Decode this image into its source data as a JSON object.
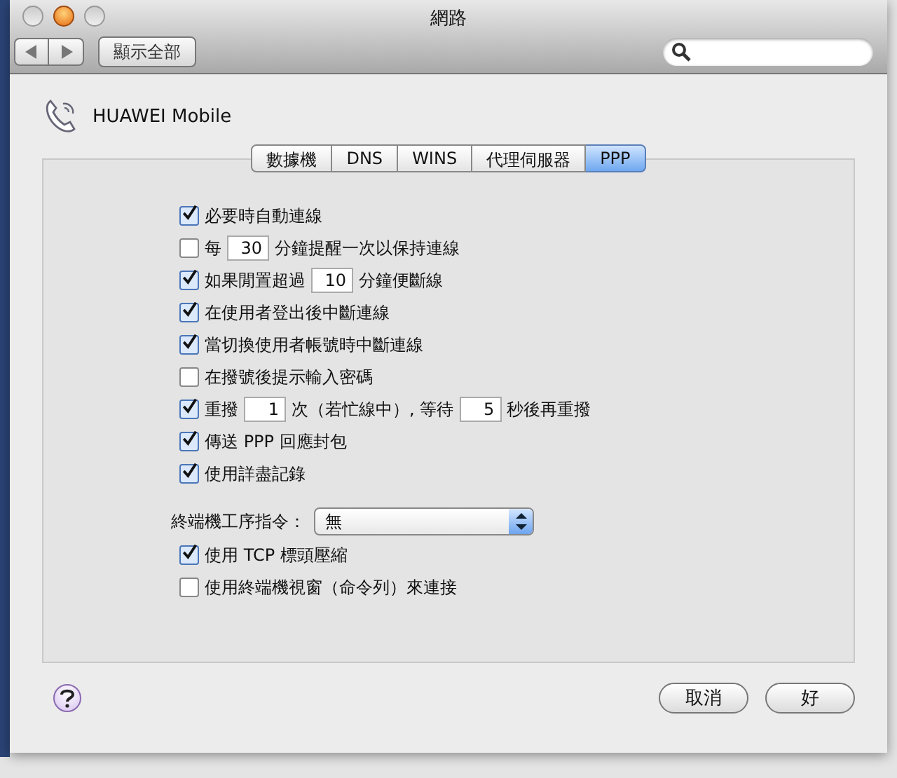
{
  "window": {
    "title": "網路",
    "show_all_button": "顯示全部"
  },
  "device": {
    "name": "HUAWEI Mobile"
  },
  "tabs": [
    {
      "label": "數據機",
      "selected": false
    },
    {
      "label": "DNS",
      "selected": false
    },
    {
      "label": "WINS",
      "selected": false
    },
    {
      "label": "代理伺服器",
      "selected": false
    },
    {
      "label": "PPP",
      "selected": true
    }
  ],
  "options": [
    {
      "checked": true,
      "parts": [
        {
          "kind": "text",
          "text": "必要時自動連線"
        }
      ]
    },
    {
      "checked": false,
      "parts": [
        {
          "kind": "text",
          "text": "每"
        },
        {
          "kind": "input",
          "value": "30"
        },
        {
          "kind": "text",
          "text": "分鐘提醒一次以保持連線"
        }
      ]
    },
    {
      "checked": true,
      "parts": [
        {
          "kind": "text",
          "text": "如果閒置超過"
        },
        {
          "kind": "input",
          "value": "10"
        },
        {
          "kind": "text",
          "text": "分鐘便斷線"
        }
      ]
    },
    {
      "checked": true,
      "parts": [
        {
          "kind": "text",
          "text": "在使用者登出後中斷連線"
        }
      ]
    },
    {
      "checked": true,
      "parts": [
        {
          "kind": "text",
          "text": "當切換使用者帳號時中斷連線"
        }
      ]
    },
    {
      "checked": false,
      "parts": [
        {
          "kind": "text",
          "text": "在撥號後提示輸入密碼"
        }
      ]
    },
    {
      "checked": true,
      "parts": [
        {
          "kind": "text",
          "text": "重撥"
        },
        {
          "kind": "input",
          "value": "1"
        },
        {
          "kind": "text",
          "text": "次（若忙線中）, 等待"
        },
        {
          "kind": "input",
          "value": "5"
        },
        {
          "kind": "text",
          "text": "秒後再重撥"
        }
      ]
    },
    {
      "checked": true,
      "parts": [
        {
          "kind": "text",
          "text": "傳送 PPP 回應封包"
        }
      ]
    },
    {
      "checked": true,
      "parts": [
        {
          "kind": "text",
          "text": "使用詳盡記錄"
        }
      ]
    }
  ],
  "terminal_script": {
    "label": "終端機工序指令：",
    "value": "無"
  },
  "options_2": [
    {
      "checked": true,
      "parts": [
        {
          "kind": "text",
          "text": "使用 TCP 標頭壓縮"
        }
      ]
    },
    {
      "checked": false,
      "parts": [
        {
          "kind": "text",
          "text": "使用終端機視窗（命令列）來連接"
        }
      ]
    }
  ],
  "buttons": [
    {
      "label": "取消"
    },
    {
      "label": "好"
    }
  ]
}
